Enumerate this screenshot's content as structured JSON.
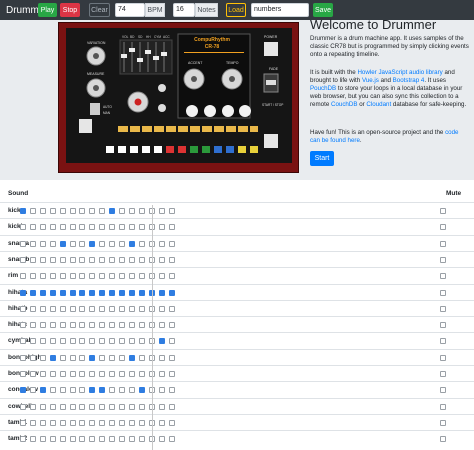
{
  "navbar": {
    "brand": "Drummer",
    "play_label": "Play",
    "stop_label": "Stop",
    "clear_label": "Clear",
    "bpm_value": "74",
    "bpm_unit": "BPM",
    "notes_value": "16",
    "notes_unit": "Notes",
    "load_label": "Load",
    "pattern_name": "numbers",
    "save_label": "Save"
  },
  "machine": {
    "name_line1": "CompuRhythm",
    "name_line2": "CR-78",
    "labels": {
      "variation": "VARIATION",
      "measure": "MEASURE",
      "accent": "ACCENT",
      "tempo": "TEMPO",
      "power": "POWER",
      "fade": "FADE",
      "startstop": "START / STOP",
      "auto": "AUTO",
      "manual": "MAN"
    },
    "fader_labels": [
      "VOL",
      "BD",
      "SD",
      "HH",
      "CYM",
      "ACC"
    ]
  },
  "jumbotron": {
    "title": "Welcome to Drummer",
    "p1": "Drummer is a drum machine app. It uses samples of the classic CR78 but is programmed by simply clicking events onto a repeating timeline.",
    "p2": "It is built with the Howler JavaScript audio library and brought to life with Vue.js and Bootstrap 4. It uses PouchDB to store your loops in a local database in your web browser, but you can also sync this collection to a remote CouchDB or Cloudant database for safe-keeping.",
    "p3": "Have fun! This is an open-source project and the code can be found here.",
    "start_label": "Start"
  },
  "grid": {
    "sound_header": "Sound",
    "mute_header": "Mute",
    "steps": 16,
    "rows": [
      {
        "name": "kicka",
        "on": [
          0,
          9
        ]
      },
      {
        "name": "kickb",
        "on": []
      },
      {
        "name": "snarea",
        "on": [
          4,
          7,
          11
        ]
      },
      {
        "name": "snareb",
        "on": []
      },
      {
        "name": "rim",
        "on": []
      },
      {
        "name": "hihata",
        "on": [
          0,
          1,
          2,
          3,
          4,
          5,
          6,
          7,
          8,
          9,
          10,
          11,
          12,
          13,
          14,
          15
        ]
      },
      {
        "name": "hihatb",
        "on": []
      },
      {
        "name": "hihatc",
        "on": []
      },
      {
        "name": "cymbal",
        "on": [
          14
        ]
      },
      {
        "name": "bongohigh",
        "on": [
          3,
          7,
          11
        ]
      },
      {
        "name": "bongolow",
        "on": []
      },
      {
        "name": "congalow",
        "on": [
          0,
          2,
          7,
          8,
          12
        ]
      },
      {
        "name": "cowbell",
        "on": []
      },
      {
        "name": "tamb1",
        "on": []
      },
      {
        "name": "tamb2",
        "on": []
      }
    ]
  }
}
